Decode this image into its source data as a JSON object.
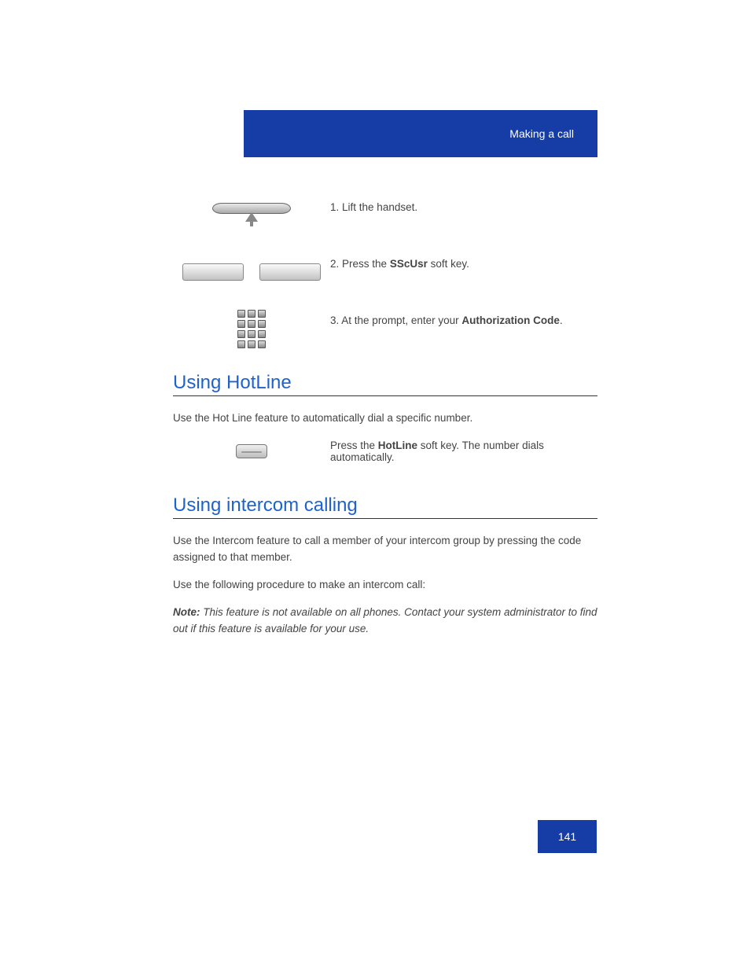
{
  "header": {
    "crumb": "Making a call"
  },
  "steps": [
    {
      "num": "1.",
      "text_a": "Lift the handset.",
      "text_b": ""
    },
    {
      "num": "2.",
      "text_a": "Press the ",
      "key": "SScUsr",
      "text_b": " soft key."
    },
    {
      "num": "3.",
      "text_a": "At the prompt, enter your ",
      "key": "Authorization Code",
      "text_b": "."
    }
  ],
  "sections": {
    "hotline": {
      "title": "Using HotLine",
      "body": "Use the Hot Line feature to automatically dial a specific number.",
      "action_prefix": "Press the ",
      "action_key": "HotLine",
      "action_suffix": " soft key.",
      "action_tail": " The number dials automatically."
    },
    "intercom": {
      "title": "Using intercom calling",
      "p1": "Use the Intercom feature to call a member of your intercom group by pressing the code assigned to that member.",
      "p2_prefix": "Use the following procedure to make an intercom call:",
      "p2_note_label": "Note:",
      "p2_note_text": " This feature is not available on all phones. Contact your system administrator to find out if this feature is available for your use."
    }
  },
  "page_number": "141"
}
